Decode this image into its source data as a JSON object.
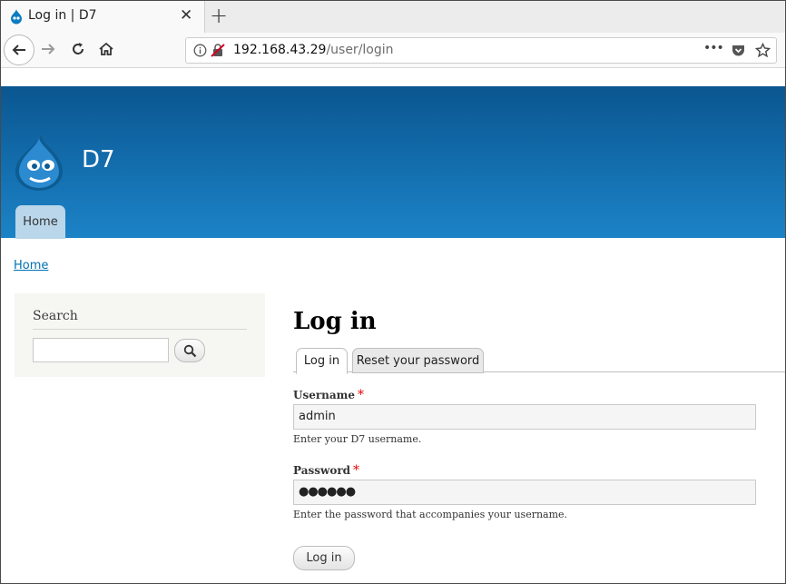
{
  "browser": {
    "tab_title": "Log in | D7",
    "url_host": "192.168.43.29",
    "url_path": "/user/login",
    "more_glyph": "•••"
  },
  "site": {
    "name": "D7",
    "nav": {
      "home": "Home"
    },
    "header_color_top": "#0a5690",
    "header_color_bottom": "#1c83c7"
  },
  "breadcrumb": {
    "home": "Home"
  },
  "sidebar": {
    "search_title": "Search",
    "search_value": ""
  },
  "main": {
    "title": "Log in",
    "tabs": [
      {
        "label": "Log in",
        "active": true
      },
      {
        "label": "Reset your password",
        "active": false
      }
    ],
    "username": {
      "label": "Username",
      "required_mark": "*",
      "value": "admin",
      "description": "Enter your D7 username."
    },
    "password": {
      "label": "Password",
      "required_mark": "*",
      "value": "●●●●●●",
      "description": "Enter the password that accompanies your username."
    },
    "submit_label": "Log in"
  }
}
